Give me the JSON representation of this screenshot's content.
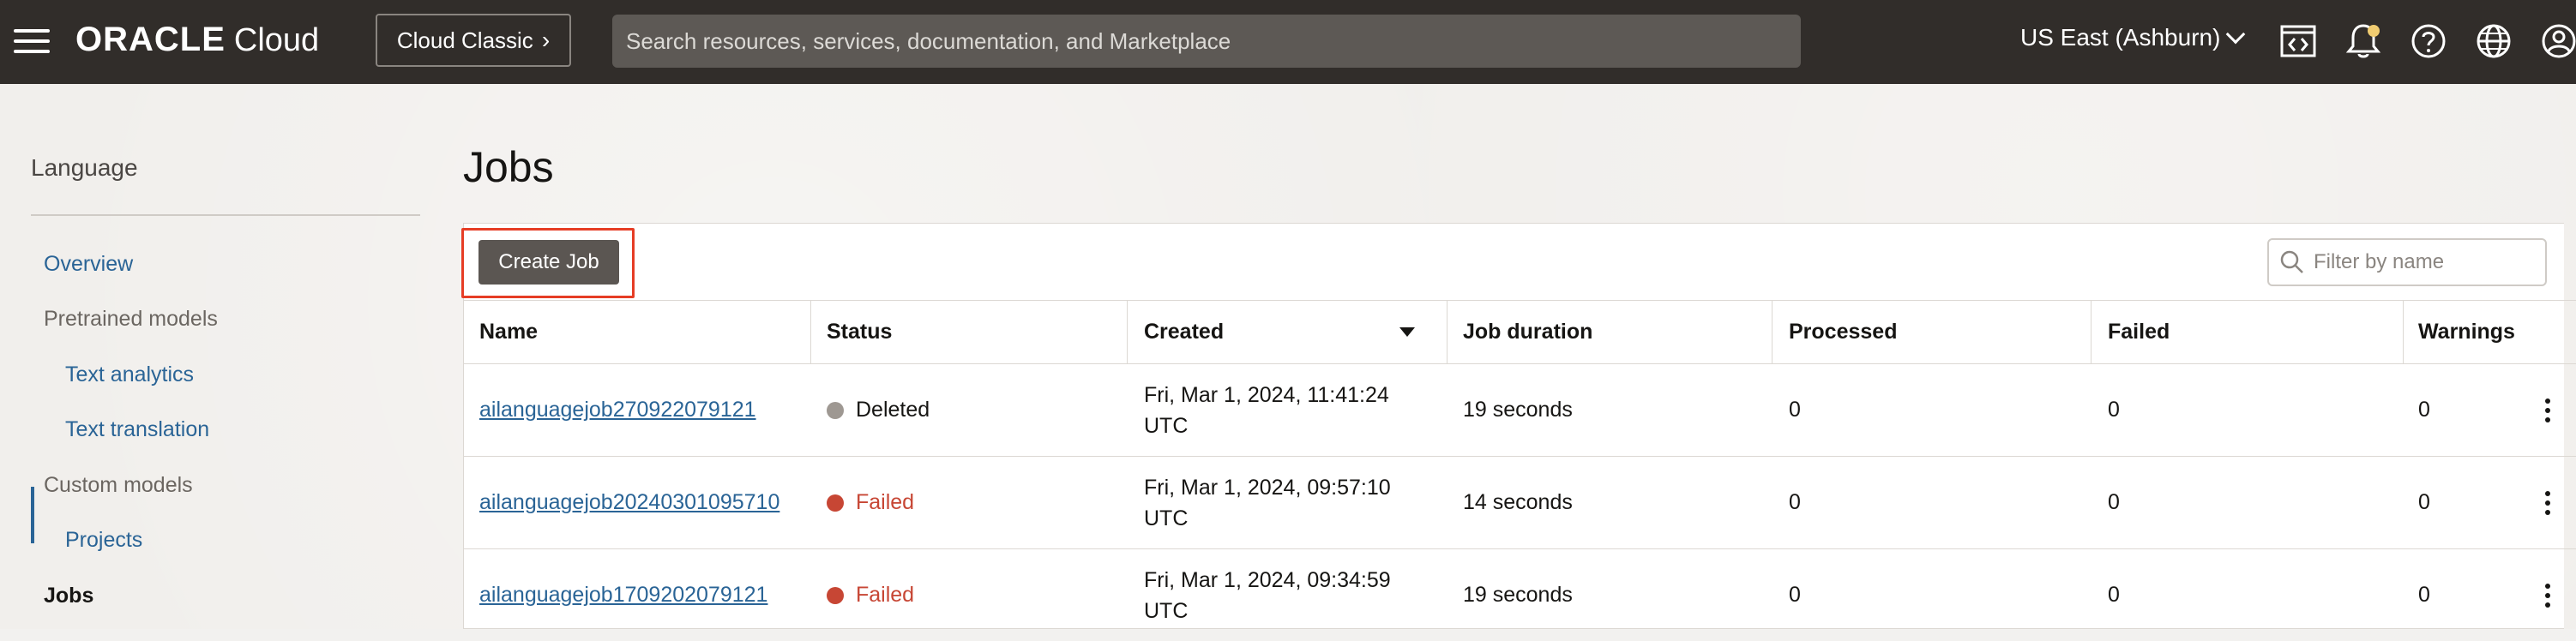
{
  "header": {
    "logo_brand": "ORACLE",
    "logo_product": "Cloud",
    "classic_button": "Cloud Classic",
    "search_placeholder": "Search resources, services, documentation, and Marketplace",
    "region": "US East (Ashburn)",
    "icons": [
      "code-editor-icon",
      "bell-icon",
      "help-icon",
      "globe-icon",
      "profile-icon"
    ],
    "notification_dot_color": "#f0cc71"
  },
  "sidebar": {
    "title": "Language",
    "items": [
      {
        "label": "Overview",
        "type": "link"
      },
      {
        "label": "Pretrained models",
        "type": "group"
      },
      {
        "label": "Text analytics",
        "type": "link"
      },
      {
        "label": "Text translation",
        "type": "link"
      },
      {
        "label": "Custom models",
        "type": "group"
      },
      {
        "label": "Projects",
        "type": "link"
      },
      {
        "label": "Jobs",
        "type": "active"
      }
    ]
  },
  "main": {
    "title": "Jobs",
    "create_button": "Create Job",
    "filter_placeholder": "Filter by name",
    "columns": [
      "Name",
      "Status",
      "Created",
      "Job duration",
      "Processed",
      "Failed",
      "Warnings"
    ],
    "rows": [
      {
        "name": "ailanguagejob270922079121",
        "status": "Deleted",
        "created_line1": "Fri, Mar 1, 2024, 11:41:24",
        "created_line2": "UTC",
        "duration": "19 seconds",
        "processed": "0",
        "failed": "0",
        "warnings": "0"
      },
      {
        "name": "ailanguagejob20240301095710",
        "status": "Failed",
        "created_line1": "Fri, Mar 1, 2024, 09:57:10",
        "created_line2": "UTC",
        "duration": "14 seconds",
        "processed": "0",
        "failed": "0",
        "warnings": "0"
      },
      {
        "name": "ailanguagejob1709202079121",
        "status": "Failed",
        "created_line1": "Fri, Mar 1, 2024, 09:34:59",
        "created_line2": "UTC",
        "duration": "19 seconds",
        "processed": "0",
        "failed": "0",
        "warnings": "0"
      }
    ]
  },
  "colors": {
    "topbar": "#312d2a",
    "link": "#2a6496",
    "failed": "#c74634",
    "deleted": "#9e9892",
    "highlight": "#e63d25"
  }
}
